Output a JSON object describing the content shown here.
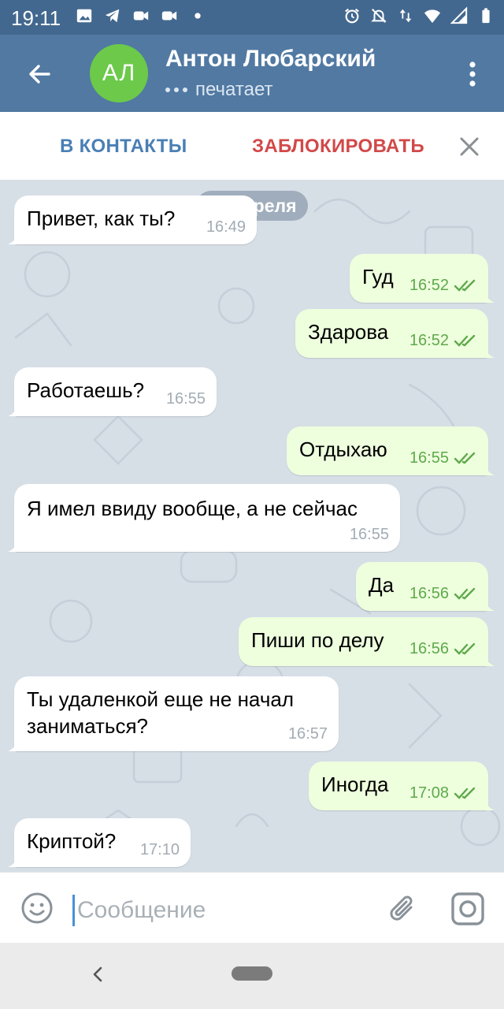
{
  "status_bar": {
    "time": "19:11",
    "left_icons": [
      "image-icon",
      "telegram-icon",
      "video-icon",
      "video-icon",
      "dot-icon"
    ],
    "right_icons": [
      "alarm-icon",
      "bell-off-icon",
      "data-arrows-icon",
      "wifi-icon",
      "signal-icon",
      "battery-icon"
    ]
  },
  "header": {
    "avatar_initials": "АЛ",
    "avatar_color": "#6cc94a",
    "name": "Антон Любарский",
    "status": "печатает"
  },
  "action_bar": {
    "add_contact_label": "В КОНТАКТЫ",
    "block_label": "ЗАБЛОКИРОВАТЬ"
  },
  "chat": {
    "date_label": "29 апреля",
    "messages": [
      {
        "direction": "in",
        "text": "Привет, как ты?",
        "time": "16:49"
      },
      {
        "direction": "out",
        "text": "Гуд",
        "time": "16:52",
        "read": true
      },
      {
        "direction": "out",
        "text": "Здарова",
        "time": "16:52",
        "read": true
      },
      {
        "direction": "in",
        "text": "Работаешь?",
        "time": "16:55"
      },
      {
        "direction": "out",
        "text": "Отдыхаю",
        "time": "16:55",
        "read": true
      },
      {
        "direction": "in",
        "text": "Я имел ввиду вообще, а не сейчас",
        "time": "16:55"
      },
      {
        "direction": "out",
        "text": "Да",
        "time": "16:56",
        "read": true
      },
      {
        "direction": "out",
        "text": "Пиши по делу",
        "time": "16:56",
        "read": true
      },
      {
        "direction": "in",
        "text_line1": "Ты удаленкой еще не начал",
        "text_line2": "заниматься?",
        "time": "16:57"
      },
      {
        "direction": "out",
        "text": "Иногда",
        "time": "17:08",
        "read": true
      },
      {
        "direction": "in",
        "text": "Криптой?",
        "time": "17:10"
      }
    ]
  },
  "composer": {
    "placeholder": "Сообщение"
  },
  "colors": {
    "status_bar": "#42688f",
    "app_bar": "#5179a2",
    "incoming_bubble": "#ffffff",
    "outgoing_bubble": "#eeffde",
    "read_check": "#5ea94b",
    "block_text": "#d24949",
    "contact_text": "#4a7fb5"
  }
}
